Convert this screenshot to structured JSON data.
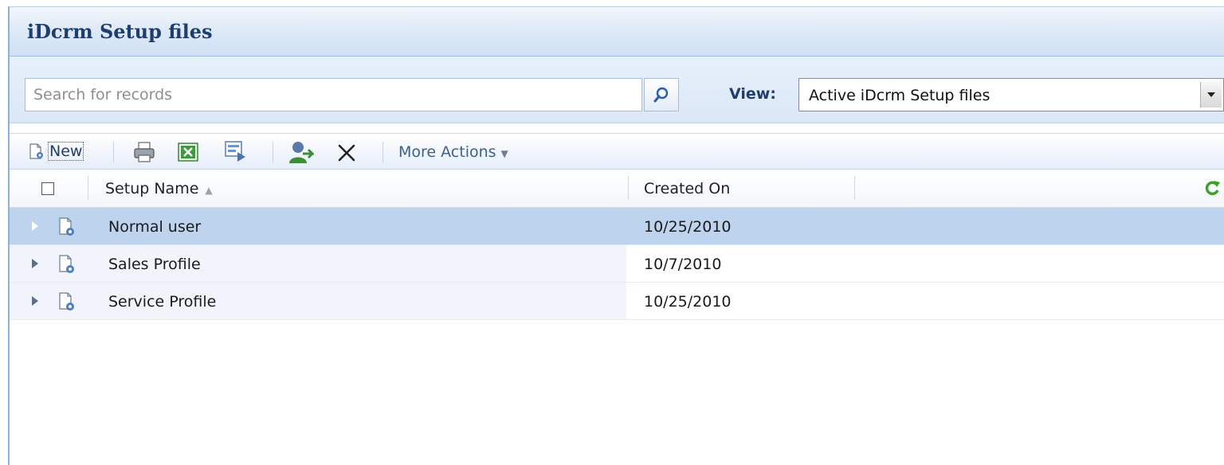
{
  "title": "iDcrm Setup files",
  "search": {
    "placeholder": "Search for records",
    "value": ""
  },
  "view": {
    "label": "View:",
    "selected": "Active iDcrm Setup files"
  },
  "toolbar": {
    "new_label": "New",
    "more_actions_label": "More Actions",
    "icons": [
      "new-record-icon",
      "print-icon",
      "export-excel-icon",
      "report-icon",
      "assign-icon",
      "delete-icon"
    ]
  },
  "grid": {
    "columns": [
      "Setup Name",
      "Created On"
    ],
    "sort": {
      "column": "Setup Name",
      "direction": "ascending"
    },
    "rows": [
      {
        "name": "Normal user",
        "created": "10/25/2010",
        "selected": true
      },
      {
        "name": "Sales Profile",
        "created": "10/7/2010",
        "selected": false
      },
      {
        "name": "Service Profile",
        "created": "10/25/2010",
        "selected": false
      }
    ]
  },
  "colors": {
    "title_text": "#1f3e6e",
    "selected_row": "#bdd3ee",
    "refresh_green": "#3aa12a"
  }
}
